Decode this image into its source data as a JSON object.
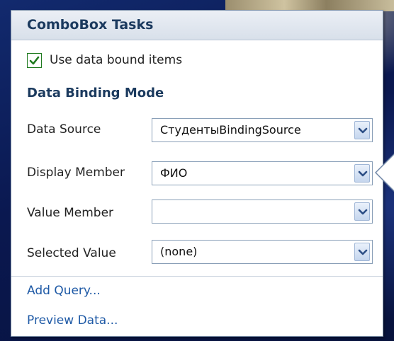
{
  "panel": {
    "title": "ComboBox Tasks"
  },
  "use_data_bound_items": {
    "label": "Use data bound items",
    "checked": true
  },
  "section": {
    "title": "Data Binding Mode"
  },
  "fields": [
    {
      "label": "Data Source",
      "value": "СтудентыBindingSource"
    },
    {
      "label": "Display Member",
      "value": "ФИО"
    },
    {
      "label": "Value Member",
      "value": ""
    },
    {
      "label": "Selected Value",
      "value": "(none)"
    }
  ],
  "links": {
    "add_query": "Add Query...",
    "preview_data": "Preview Data..."
  },
  "icons": {
    "checkbox": "checkmark-icon",
    "dropdown": "chevron-down-icon"
  },
  "colors": {
    "header_text": "#1b3a5e",
    "link": "#1f5aa6",
    "check": "#1f7a1f",
    "background": "#0a1850"
  }
}
